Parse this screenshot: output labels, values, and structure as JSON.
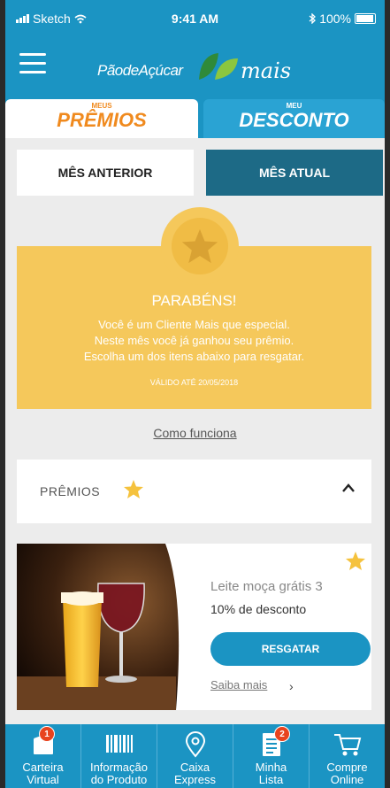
{
  "status": {
    "carrier": "Sketch",
    "time": "9:41 AM",
    "battery": "100%"
  },
  "header": {
    "brand": "PãodeAçúcar",
    "brand_suffix": "mais"
  },
  "tabs": [
    {
      "small": "MEUS",
      "label": "PRÊMIOS"
    },
    {
      "small": "MEU",
      "label": "DESCONTO"
    }
  ],
  "segments": {
    "prev": "MÊS ANTERIOR",
    "current": "MÊS ATUAL"
  },
  "reward_card": {
    "title": "PARABÉNS!",
    "lines": [
      "Você é um Cliente Mais que especial.",
      "Neste mês você já ganhou seu prêmio.",
      "Escolha um dos itens abaixo para resgatar."
    ],
    "valid": "VÁLIDO ATÉ 20/05/2018"
  },
  "how_it_works": "Como funciona",
  "accordion": {
    "label": "PRÊMIOS"
  },
  "prize": {
    "name": "Leite moça grátis 3",
    "discount": "10% de desconto",
    "redeem": "RESGATAR",
    "more": "Saiba mais"
  },
  "bottom_nav": [
    {
      "line1": "Carteira",
      "line2": "Virtual",
      "badge": "1"
    },
    {
      "line1": "Informação",
      "line2": "do Produto"
    },
    {
      "line1": "Caixa",
      "line2": "Express"
    },
    {
      "line1": "Minha",
      "line2": "Lista",
      "badge": "2"
    },
    {
      "line1": "Compre",
      "line2": "Online"
    }
  ],
  "colors": {
    "primary": "#1b94c3",
    "accent": "#f08a1e",
    "card": "#f5c85b",
    "segment_active": "#1d6a86"
  }
}
